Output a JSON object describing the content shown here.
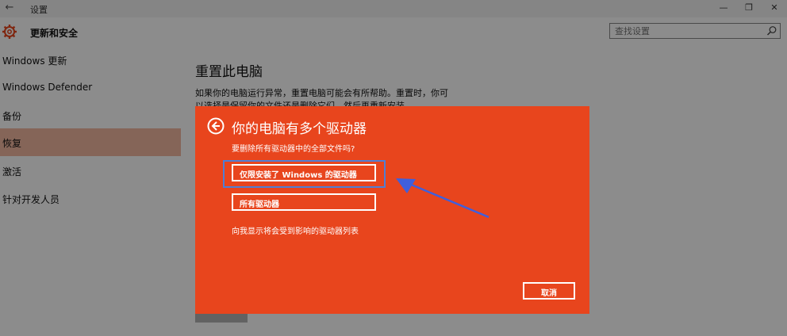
{
  "window": {
    "title": "设置"
  },
  "header": {
    "title": "更新和安全",
    "search_placeholder": "查找设置"
  },
  "sidebar": {
    "items": [
      {
        "label": "Windows 更新"
      },
      {
        "label": "Windows Defender"
      },
      {
        "label": "备份"
      },
      {
        "label": "恢复"
      },
      {
        "label": "激活"
      },
      {
        "label": "针对开发人员"
      }
    ]
  },
  "main": {
    "title": "重置此电脑",
    "description": "如果你的电脑运行异常，重置电脑可能会有所帮助。重置时，你可以选择是保留你的文件还是删除它们，然后再重新安装 Windows。"
  },
  "dialog": {
    "title": "你的电脑有多个驱动器",
    "subtitle": "要删除所有驱动器中的全部文件吗?",
    "option_windows_drive": "仅限安装了 Windows 的驱动器",
    "option_all_drives": "所有驱动器",
    "show_affected": "向我显示将会受到影响的驱动器列表",
    "cancel_label": "取消",
    "colors": {
      "background": "#e8451d",
      "highlight": "#4f7fd4"
    }
  }
}
